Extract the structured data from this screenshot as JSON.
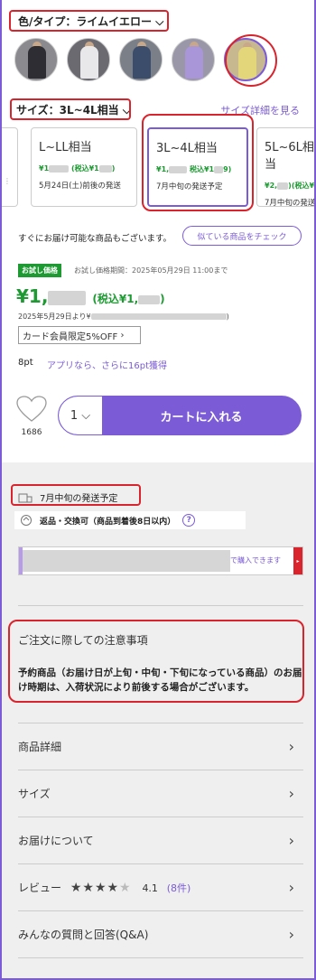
{
  "color": {
    "label": "色/タイプ：ライムイエロー",
    "chevron": "chevron-down-icon"
  },
  "thumbnails": [
    {
      "alt": "black-outfit",
      "tone": "#2d2d33",
      "bg": "#8a8a8f"
    },
    {
      "alt": "white-shirt",
      "tone": "#e8e8ea",
      "bg": "#6a6a70"
    },
    {
      "alt": "navy-jacket",
      "tone": "#3c4d6b",
      "bg": "#7b7f88"
    },
    {
      "alt": "lavender-shirt",
      "tone": "#a996d8",
      "bg": "#9a98a8"
    },
    {
      "alt": "lime-yellow-shirt",
      "tone": "#e3d67a",
      "bg": "#c8b88f"
    }
  ],
  "size": {
    "label": "サイズ：3L~4L相当",
    "detail_link": "サイズ詳細を見る",
    "cards": [
      {
        "name": "L~LL相当",
        "price": "¥1",
        "tax": "(税込¥1",
        "tax_end": ")",
        "ship": "5月24日(土)前後の発送"
      },
      {
        "name": "3L~4L相当",
        "price": "¥1,",
        "tax": "税込¥1",
        "tax_end": "9)",
        "ship": "7月中旬の発送予定"
      },
      {
        "name": "5L~6L相当",
        "price": "¥2,",
        "tax": ")(税込¥",
        "tax_end": "",
        "ship": "7月中旬の発送"
      }
    ]
  },
  "stock": {
    "text": "すぐにお届け可能な商品もございます。",
    "similar_button": "似ている商品をチェック"
  },
  "trial": {
    "badge": "お試し価格",
    "period": "お試し価格期間：2025年05月29日 11:00まで"
  },
  "price": {
    "main": "¥1,",
    "tax_open": "(税込¥1,",
    "tax_close": ")",
    "from": "2025年5月29日より¥"
  },
  "card_discount": "カード会員限定5%OFF",
  "points": {
    "pt": "8pt",
    "app": "アプリなら、さらに16pt獲得"
  },
  "favorite": {
    "count": "1686"
  },
  "cart": {
    "qty": "1",
    "button": "カートに入れる"
  },
  "shipping_note": "7月中旬の発送予定",
  "returns": {
    "text": "返品・交換可（商品到着後8日以内）",
    "help": "?"
  },
  "banner": {
    "text": "で購入できます",
    "tab": "▸"
  },
  "notice": {
    "title": "ご注文に際しての注意事項",
    "body": "予約商品（お届け日が上旬・中旬・下旬になっている商品）のお届け時期は、入荷状況により前後する場合がございます。"
  },
  "menu": [
    {
      "label": "商品詳細"
    },
    {
      "label": "サイズ"
    },
    {
      "label": "お届けについて"
    },
    {
      "label": "レビュー",
      "rating": "4.1",
      "count": "(8件)",
      "stars": 4
    },
    {
      "label": "みんなの質問と回答(Q&A)"
    }
  ],
  "colors": {
    "accent": "#7b5cd6",
    "price_green": "#1e9a33",
    "highlight_red": "#d9232d"
  }
}
